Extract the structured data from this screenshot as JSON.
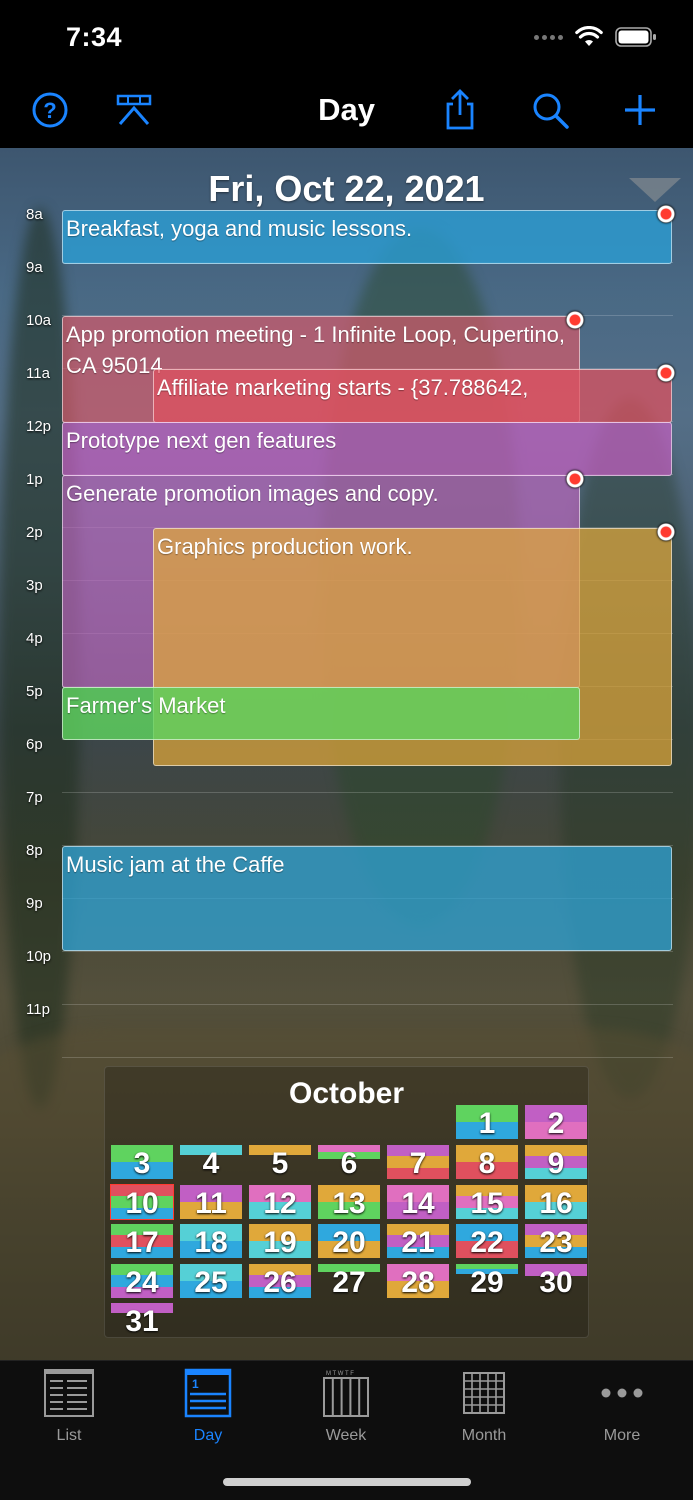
{
  "status_bar": {
    "time": "7:34"
  },
  "nav": {
    "title": "Day",
    "help_icon": "help-circle-icon",
    "layout_icon": "layout-icon",
    "share_icon": "share-icon",
    "search_icon": "search-icon",
    "add_icon": "plus-icon",
    "accent": "#1a84ff"
  },
  "day": {
    "date": "Fri, Oct 22, 2021",
    "hours": [
      "8a",
      "9a",
      "10a",
      "11a",
      "12p",
      "1p",
      "2p",
      "3p",
      "4p",
      "5p",
      "6p",
      "7p",
      "8p",
      "9p",
      "10p",
      "11p"
    ],
    "events": [
      {
        "title": "Breakfast, yoga and music lessons.",
        "color": "#2a9fd6",
        "alarm": true
      },
      {
        "title": "App promotion meeting - 1 Infinite Loop, Cupertino, CA 95014",
        "color": "#d45a6a",
        "alarm": true
      },
      {
        "title": "Affiliate marketing starts - {37.788642,",
        "color": "#e0505e",
        "alarm": true
      },
      {
        "title": "Prototype next gen features",
        "color": "#c35fc1",
        "alarm": false
      },
      {
        "title": "Generate promotion images and copy.",
        "color": "#c066c0",
        "alarm": true
      },
      {
        "title": "Graphics production work.",
        "color": "#e0a83a",
        "alarm": true
      },
      {
        "title": "Farmer's Market",
        "color": "#5fd35f",
        "alarm": false
      },
      {
        "title": "Music jam at the Caffe",
        "color": "#2ea6db",
        "alarm": false
      }
    ]
  },
  "mini_month": {
    "title": "October",
    "today": "10",
    "days": [
      "1",
      "2",
      "3",
      "4",
      "5",
      "6",
      "7",
      "8",
      "9",
      "10",
      "11",
      "12",
      "13",
      "14",
      "15",
      "16",
      "17",
      "18",
      "19",
      "20",
      "21",
      "22",
      "23",
      "24",
      "25",
      "26",
      "27",
      "28",
      "29",
      "30",
      "31"
    ]
  },
  "tabs": [
    {
      "label": "List",
      "icon": "list-icon",
      "active": false
    },
    {
      "label": "Day",
      "icon": "day-icon",
      "active": true
    },
    {
      "label": "Week",
      "icon": "week-icon",
      "active": false
    },
    {
      "label": "Month",
      "icon": "month-icon",
      "active": false
    },
    {
      "label": "More",
      "icon": "more-icon",
      "active": false
    }
  ]
}
